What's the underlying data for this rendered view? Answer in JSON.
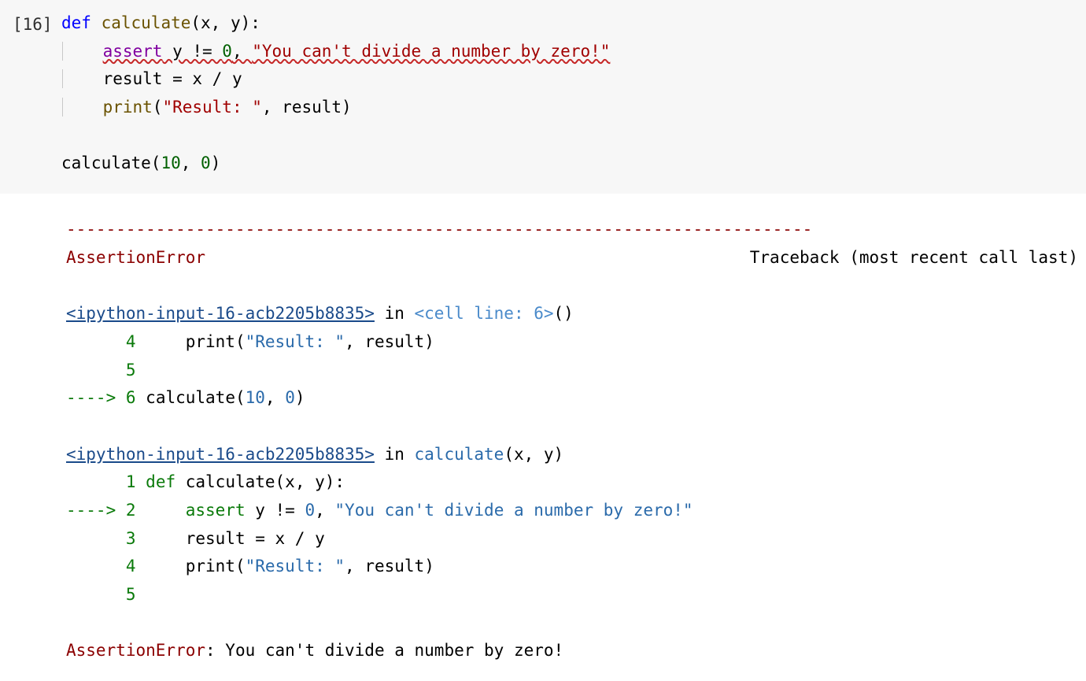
{
  "input": {
    "prompt": "[16]",
    "code": {
      "line1": {
        "def": "def",
        "name": "calculate",
        "args": "(x, y):"
      },
      "line2": {
        "indent": "    ",
        "assert": "assert",
        "cond_pre": " y != ",
        "zero": "0",
        "comma": ", ",
        "msg": "\"You can't divide a number by zero!\""
      },
      "line3": {
        "indent": "    ",
        "text": "result = x / y"
      },
      "line4": {
        "indent": "    ",
        "print": "print",
        "open": "(",
        "s": "\"Result: \"",
        "rest": ", result)"
      },
      "line5_blank": "",
      "line6": {
        "call_pre": "calculate(",
        "a": "10",
        "sep": ", ",
        "b": "0",
        "close": ")"
      }
    }
  },
  "output": {
    "sep": "---------------------------------------------------------------------------",
    "err_header_left": "AssertionError",
    "err_header_right": "Traceback (most recent call last)",
    "frame1": {
      "file": "<ipython-input-16-acb2205b8835>",
      "in": " in ",
      "loc": "<cell line: 6>",
      "after": "()",
      "l4": {
        "no": "      4",
        "pre": "     ",
        "print": "print",
        "open": "(",
        "s": "\"Result: \"",
        "rest": ", result)"
      },
      "l5": {
        "no": "      5"
      },
      "l6": {
        "arrow": "----> ",
        "no": "6",
        "pre": " ",
        "call": "calculate",
        "open": "(",
        "a": "10",
        "sep": ", ",
        "b": "0",
        "close": ")"
      }
    },
    "frame2": {
      "file": "<ipython-input-16-acb2205b8835>",
      "in": " in ",
      "fn": "calculate",
      "args": "(x, y)",
      "l1": {
        "no": "      1",
        "pre": " ",
        "def": "def",
        "rest": " calculate(x, y):"
      },
      "l2": {
        "arrow": "----> ",
        "no": "2",
        "pre": "     ",
        "assert": "assert",
        "mid": " y != ",
        "zero": "0",
        "comma": ", ",
        "msg": "\"You can't divide a number by zero!\""
      },
      "l3": {
        "no": "      3",
        "pre": "     ",
        "text": "result = x / y"
      },
      "l4": {
        "no": "      4",
        "pre": "     ",
        "print": "print",
        "open": "(",
        "s": "\"Result: \"",
        "rest": ", result)"
      },
      "l5": {
        "no": "      5"
      }
    },
    "final": {
      "name": "AssertionError",
      "msg": ": You can't divide a number by zero!"
    }
  }
}
